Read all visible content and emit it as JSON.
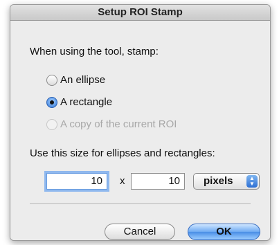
{
  "dialog": {
    "title": "Setup ROI Stamp",
    "prompt": "When using the tool, stamp:",
    "options": [
      {
        "label": "An ellipse",
        "selected": false,
        "enabled": true
      },
      {
        "label": "A rectangle",
        "selected": true,
        "enabled": true
      },
      {
        "label": "A copy of the current ROI",
        "selected": false,
        "enabled": false
      }
    ],
    "size_label": "Use this size for ellipses and rectangles:",
    "width_value": "10",
    "times_symbol": "x",
    "height_value": "10",
    "unit_selected": "pixels",
    "cancel_label": "Cancel",
    "ok_label": "OK"
  },
  "colors": {
    "accent": "#2f75d8",
    "dialog_bg": "#ececec"
  },
  "icons": {
    "select_arrows": "up-down-arrows-icon"
  }
}
